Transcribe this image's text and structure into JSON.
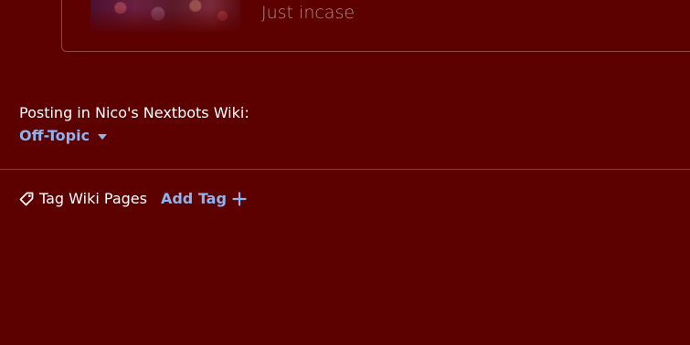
{
  "preview": {
    "caption": "Just incase"
  },
  "posting": {
    "label": "Posting in Nico's Nextbots Wiki:",
    "category": "Off-Topic"
  },
  "tags": {
    "label": "Tag Wiki Pages",
    "add_label": "Add Tag"
  },
  "colors": {
    "background": "#5c0000",
    "accent": "#8cb4f0",
    "text": "#ffffff"
  },
  "icons": {
    "tag": "tag-icon",
    "caret": "caret-down-icon",
    "plus": "plus-icon"
  }
}
